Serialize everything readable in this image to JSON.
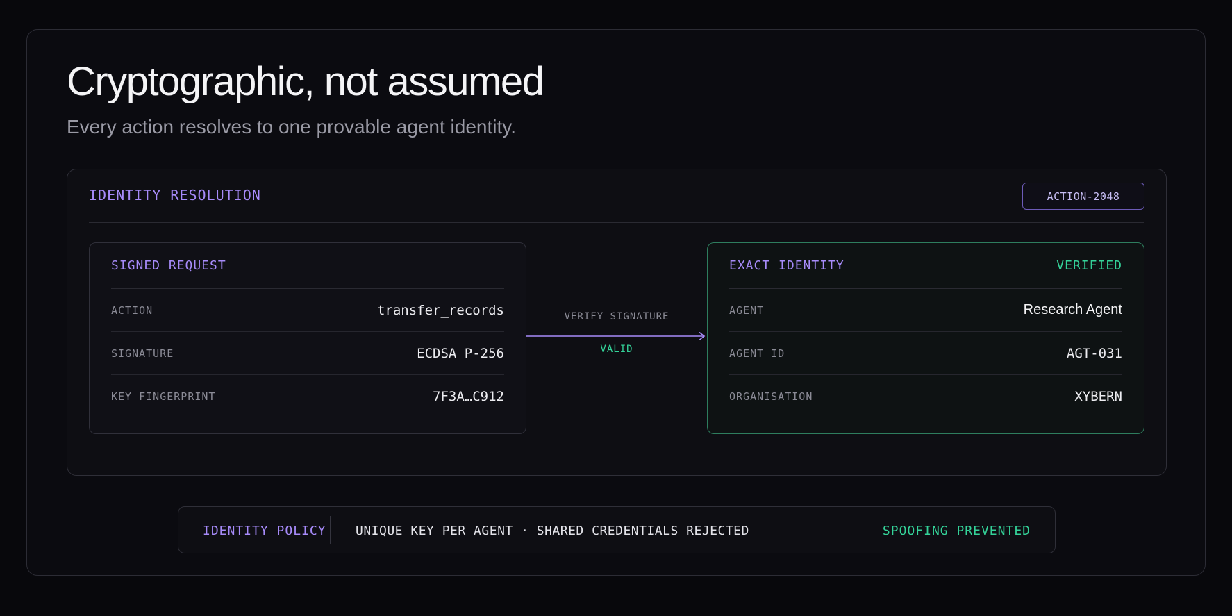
{
  "header": {
    "title": "Cryptographic, not assumed",
    "subtitle": "Every action resolves to one provable agent identity."
  },
  "panel": {
    "title": "IDENTITY RESOLUTION",
    "action_badge": "ACTION-2048"
  },
  "signed_request": {
    "title": "SIGNED REQUEST",
    "rows": [
      {
        "label": "ACTION",
        "value": "transfer_records"
      },
      {
        "label": "SIGNATURE",
        "value": "ECDSA P-256"
      },
      {
        "label": "KEY FINGERPRINT",
        "value": "7F3A…C912"
      }
    ]
  },
  "connector": {
    "label": "VERIFY SIGNATURE",
    "status": "VALID"
  },
  "exact_identity": {
    "title": "EXACT IDENTITY",
    "status": "VERIFIED",
    "rows": [
      {
        "label": "AGENT",
        "value": "Research Agent"
      },
      {
        "label": "AGENT ID",
        "value": "AGT-031"
      },
      {
        "label": "ORGANISATION",
        "value": "XYBERN"
      }
    ]
  },
  "policy": {
    "label": "IDENTITY POLICY",
    "text": "UNIQUE KEY PER AGENT · SHARED CREDENTIALS REJECTED",
    "status": "SPOOFING PREVENTED"
  },
  "colors": {
    "accent_purple": "#a78bfa",
    "accent_green": "#34d399",
    "background": "#08080c"
  }
}
